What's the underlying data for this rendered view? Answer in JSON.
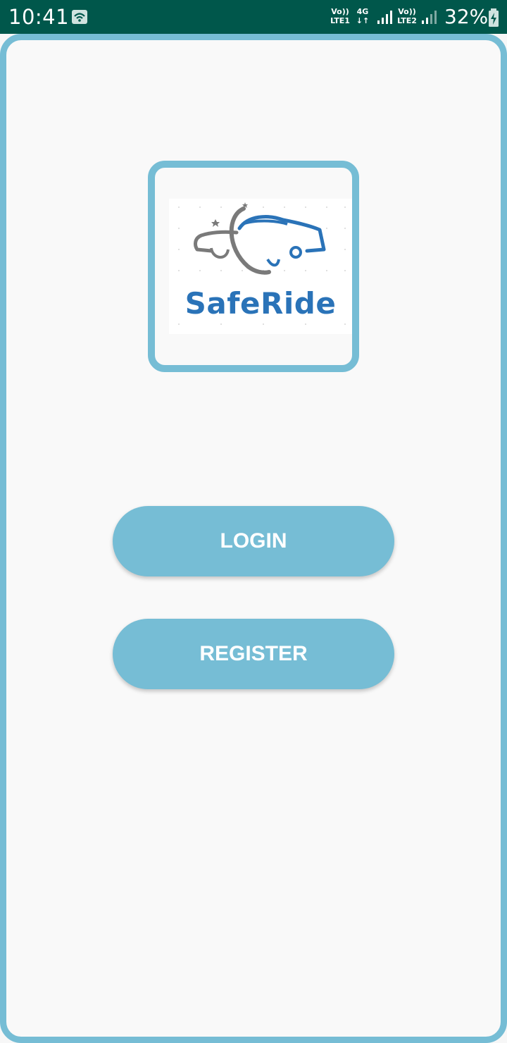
{
  "status_bar": {
    "time": "10:41",
    "sim1_volte": "Vo))",
    "sim1_lte": "LTE1",
    "network_type": "4G",
    "network_arrows": "↓↑",
    "sim2_volte": "Vo))",
    "sim2_lte": "LTE2",
    "battery_percent": "32%",
    "notification_icon": "message-icon",
    "signal_icon": "signal-icon",
    "battery_icon": "battery-charging-icon"
  },
  "logo": {
    "text": "SafeRide",
    "icon": "car-logo-icon"
  },
  "buttons": {
    "login_label": "LOGIN",
    "register_label": "REGISTER"
  },
  "colors": {
    "status_bar": "#00574b",
    "accent": "#76bdd5",
    "logo_blue": "#2a73b8",
    "logo_gray": "#7a7a7a",
    "background": "#f9f9f9"
  }
}
